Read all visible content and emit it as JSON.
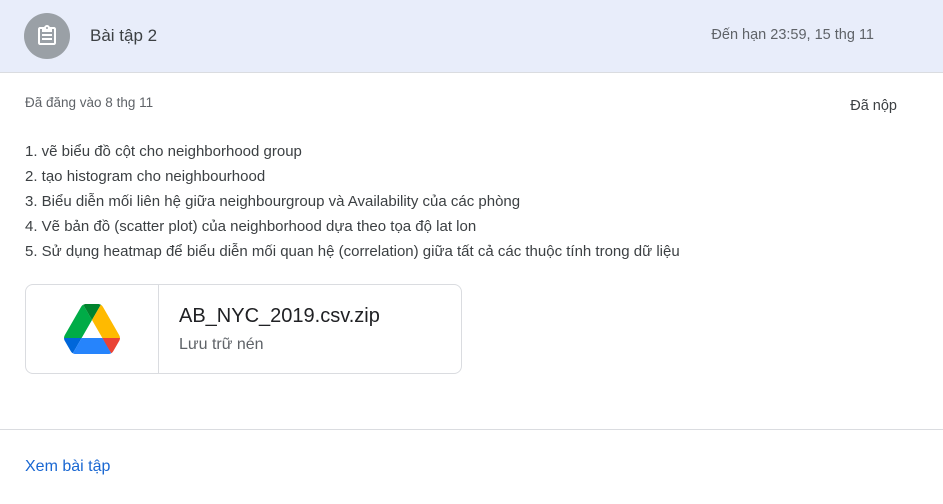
{
  "header": {
    "title": "Bài tập 2",
    "due": "Đến hạn 23:59, 15 thg 11",
    "icon": "assignment-icon"
  },
  "meta": {
    "posted": "Đã đăng vào 8 thg 11",
    "status": "Đã nộp"
  },
  "instructions": [
    "1. vẽ biểu đồ cột cho neighborhood group",
    "2. tạo histogram cho neighbourhood",
    "3. Biểu diễn mối liên hệ giữa neighbourgroup và Availability của các phòng",
    "4. Vẽ bản đồ (scatter plot) của neighborhood dựa theo tọa độ lat lon",
    "5. Sử dụng heatmap để biểu diễn mối quan hệ (correlation) giữa tất cả các thuộc tính trong dữ liệu"
  ],
  "attachment": {
    "name": "AB_NYC_2019.csv.zip",
    "type": "Lưu trữ nén",
    "icon": "google-drive-icon"
  },
  "footer": {
    "view_link": "Xem bài tập"
  },
  "colors": {
    "header_bg": "#e8edfa",
    "link": "#1967d2",
    "icon_circle": "#9aa0a6"
  }
}
